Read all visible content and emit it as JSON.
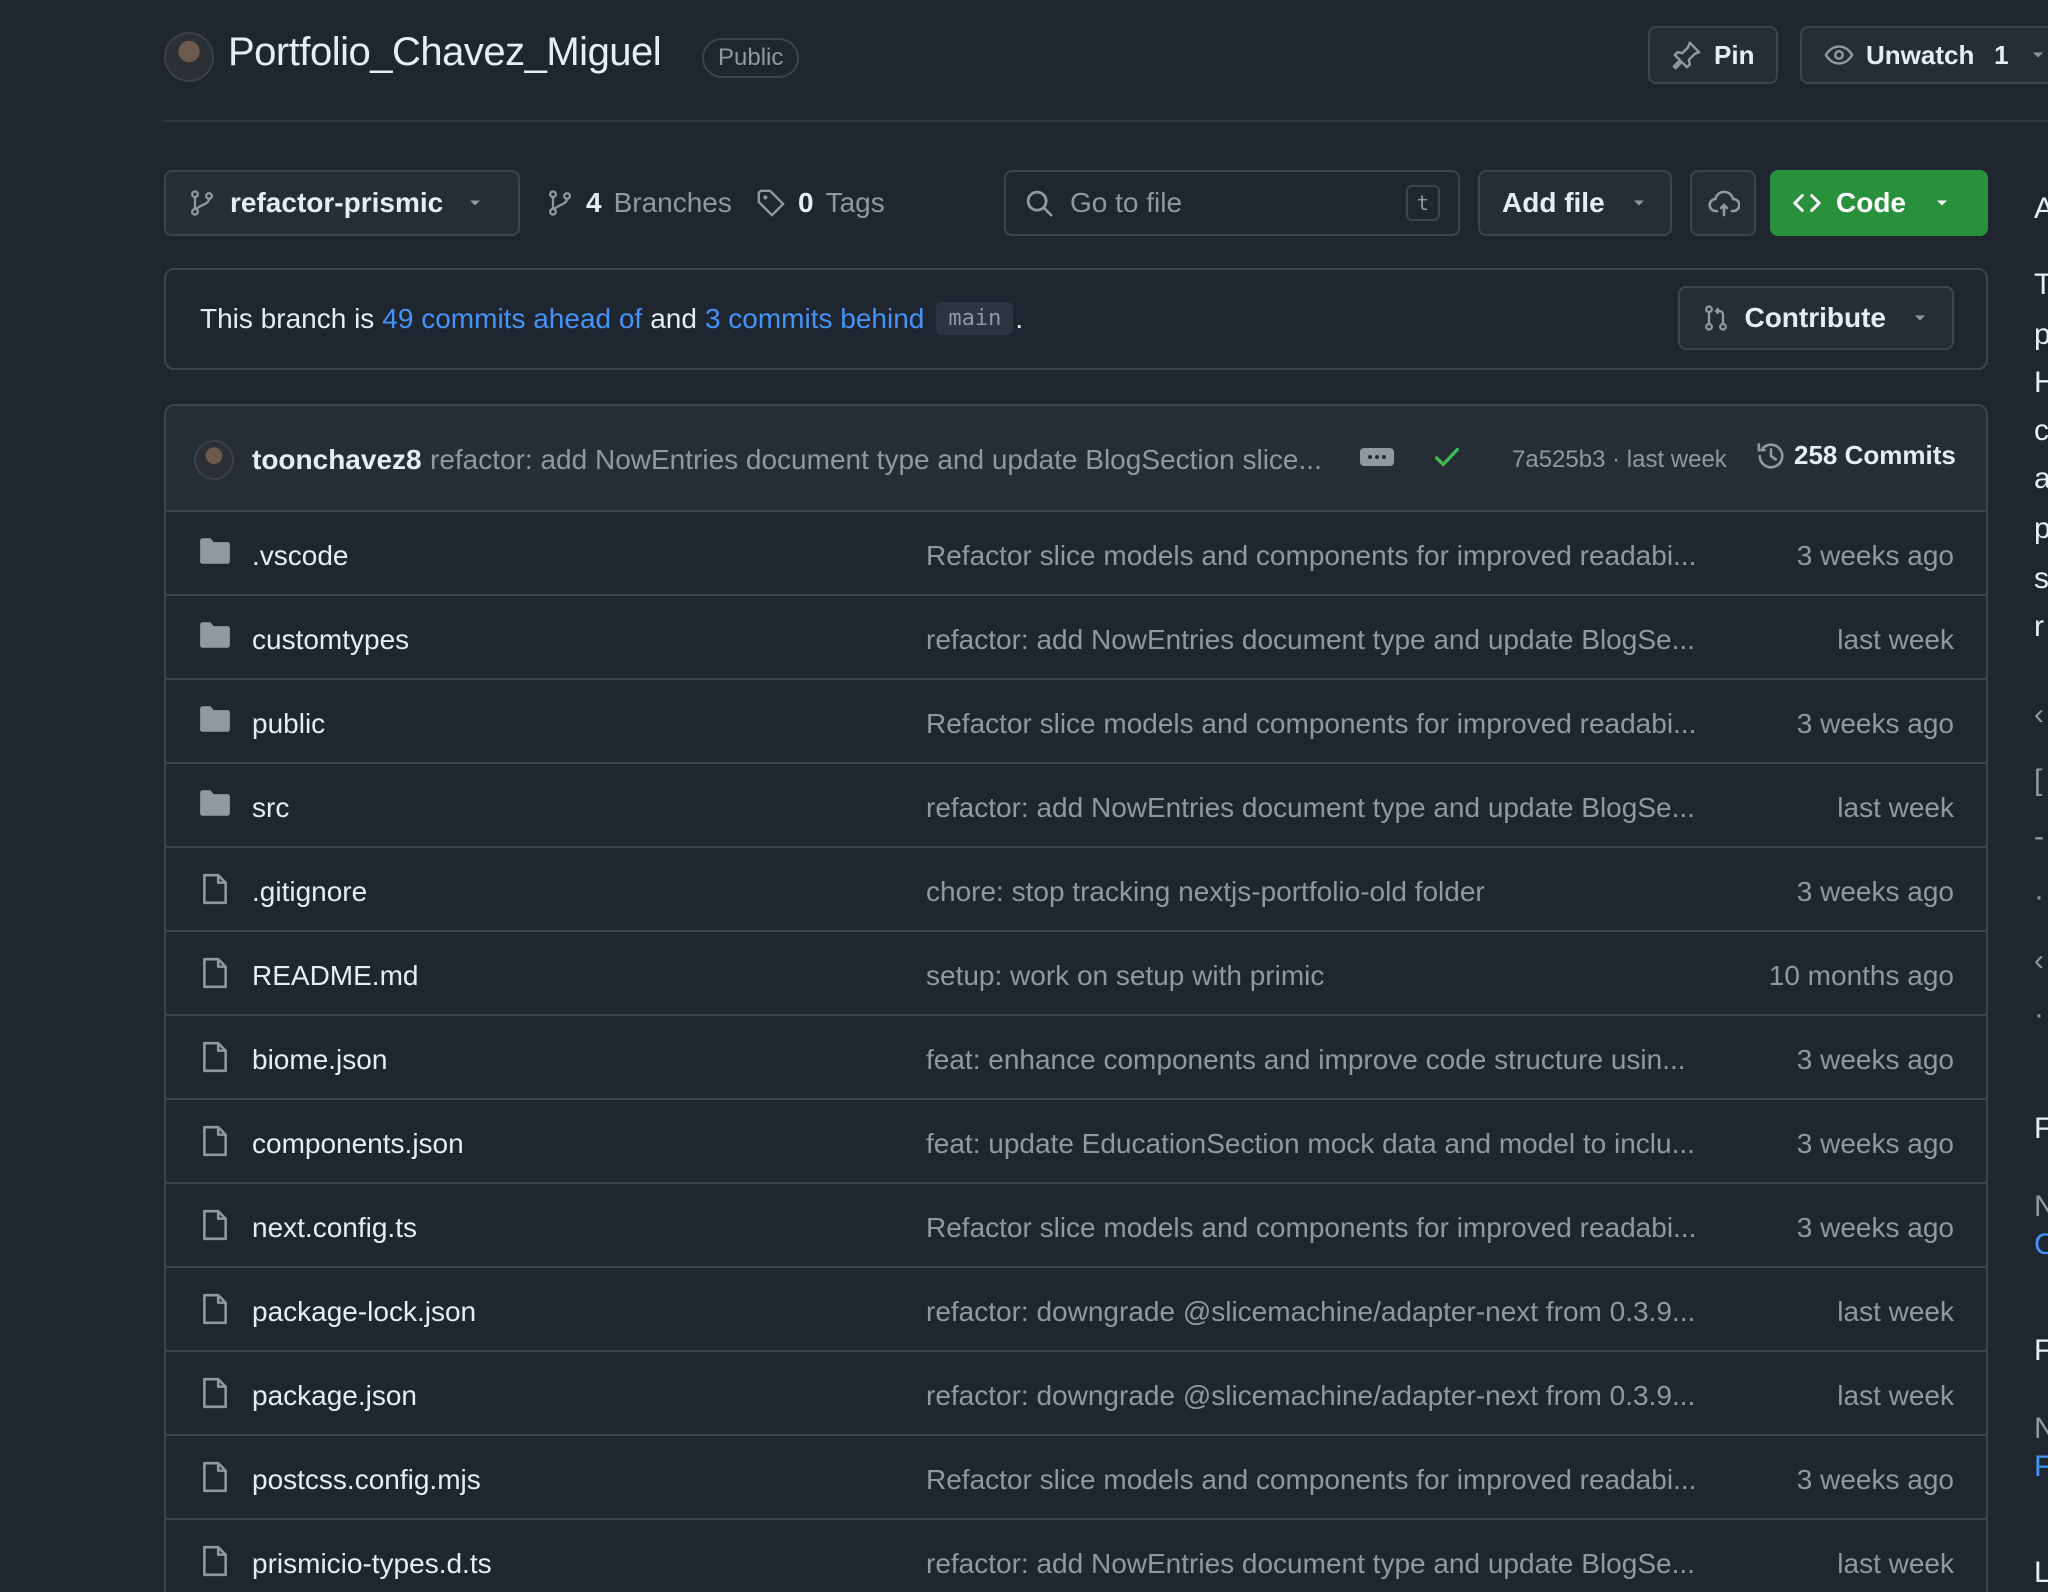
{
  "header": {
    "repo_name": "Portfolio_Chavez_Miguel",
    "visibility": "Public",
    "pin_label": "Pin",
    "watch_label": "Unwatch",
    "watch_count": "1"
  },
  "toolbar": {
    "branch": "refactor-prismic",
    "branches_count": "4",
    "branches_label": "Branches",
    "tags_count": "0",
    "tags_label": "Tags",
    "search_placeholder": "Go to file",
    "search_shortcut": "t",
    "add_file_label": "Add file",
    "code_label": "Code"
  },
  "branch_status": {
    "prefix": "This branch is",
    "ahead": "49 commits ahead of",
    "and": "and",
    "behind": "3 commits behind",
    "base": "main",
    "suffix": ".",
    "contribute_label": "Contribute"
  },
  "latest_commit": {
    "author": "toonchavez8",
    "message": "refactor: add NowEntries document type and update BlogSection slice...",
    "hash_time": "7a525b3 · last week",
    "commits_label": "258 Commits"
  },
  "files": [
    {
      "name": ".vscode",
      "type": "folder",
      "message": "Refactor slice models and components for improved readabi...",
      "time": "3 weeks ago"
    },
    {
      "name": "customtypes",
      "type": "folder",
      "message": "refactor: add NowEntries document type and update BlogSe...",
      "time": "last week"
    },
    {
      "name": "public",
      "type": "folder",
      "message": "Refactor slice models and components for improved readabi...",
      "time": "3 weeks ago"
    },
    {
      "name": "src",
      "type": "folder",
      "message": "refactor: add NowEntries document type and update BlogSe...",
      "time": "last week"
    },
    {
      "name": ".gitignore",
      "type": "file",
      "message": "chore: stop tracking nextjs-portfolio-old folder",
      "time": "3 weeks ago"
    },
    {
      "name": "README.md",
      "type": "file",
      "message": "setup: work on setup with primic",
      "time": "10 months ago"
    },
    {
      "name": "biome.json",
      "type": "file",
      "message": "feat: enhance components and improve code structure usin...",
      "time": "3 weeks ago"
    },
    {
      "name": "components.json",
      "type": "file",
      "message": "feat: update EducationSection mock data and model to inclu...",
      "time": "3 weeks ago"
    },
    {
      "name": "next.config.ts",
      "type": "file",
      "message": "Refactor slice models and components for improved readabi...",
      "time": "3 weeks ago"
    },
    {
      "name": "package-lock.json",
      "type": "file",
      "message": "refactor: downgrade @slicemachine/adapter-next from 0.3.9...",
      "time": "last week"
    },
    {
      "name": "package.json",
      "type": "file",
      "message": "refactor: downgrade @slicemachine/adapter-next from 0.3.9...",
      "time": "last week"
    },
    {
      "name": "postcss.config.mjs",
      "type": "file",
      "message": "Refactor slice models and components for improved readabi...",
      "time": "3 weeks ago"
    },
    {
      "name": "prismicio-types.d.ts",
      "type": "file",
      "message": "refactor: add NowEntries document type and update BlogSe...",
      "time": "last week"
    }
  ],
  "colors": {
    "background": "#1f2630",
    "border": "#3d444d",
    "link": "#4493f8",
    "code_button": "#29903b",
    "muted_text": "#9198a1"
  }
}
